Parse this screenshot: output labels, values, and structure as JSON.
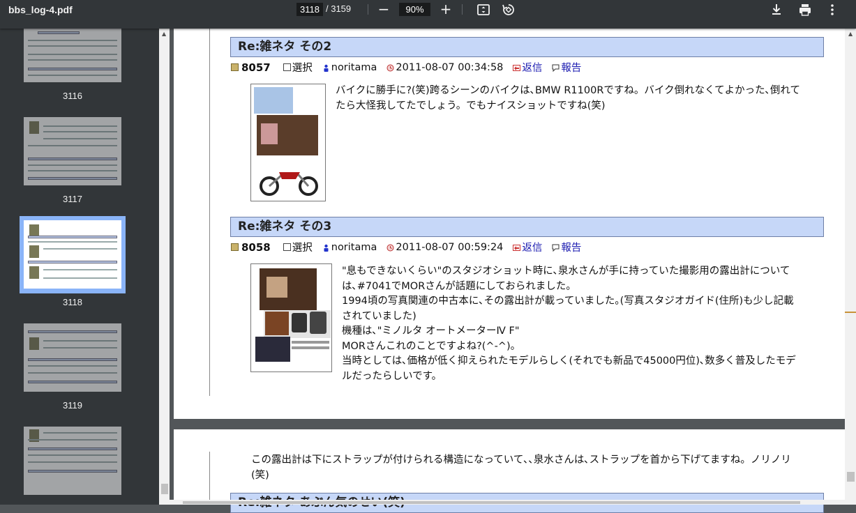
{
  "toolbar": {
    "file_name": "bbs_log-4.pdf",
    "page_current": "3118",
    "page_total": "/ 3159",
    "zoom_minus": "−",
    "zoom_level": "90%",
    "zoom_plus": "+",
    "icons": [
      "fit-page-icon",
      "rotate-icon",
      "download-icon",
      "print-icon",
      "more-options-icon"
    ]
  },
  "sidebar": {
    "thumbnails": [
      {
        "label": "3116"
      },
      {
        "label": "3117"
      },
      {
        "label": "3118",
        "selected": true
      },
      {
        "label": "3119"
      },
      {
        "label": ""
      }
    ]
  },
  "posts": [
    {
      "title": "Re:雑ネタ その2",
      "number": "8057",
      "select_label": "選択",
      "author": "noritama",
      "datetime": "2011-08-07 00:34:58",
      "reply": "返信",
      "report": "報告",
      "body": [
        "バイクに勝手に?(笑)跨るシーンのバイクは､BMW R1100Rですね。バイク倒れなくてよかった､倒れて",
        "たら大怪我してたでしょう。でもナイスショットですね(笑)"
      ]
    },
    {
      "title": "Re:雑ネタ その3",
      "number": "8058",
      "select_label": "選択",
      "author": "noritama",
      "datetime": "2011-08-07 00:59:24",
      "reply": "返信",
      "report": "報告",
      "body": [
        "\"息もできないくらい\"のスタジオショット時に､泉水さんが手に持っていた撮影用の露出計について",
        "は､#7041でMORさんが話題にしておられました。",
        "1994頃の写真関連の中古本に､その露出計が載っていました｡(写真スタジオガイド(住所)も少し記載",
        "されていました)",
        "機種は､\"ミノルタ オートメーターⅣ F\"",
        "MORさんこれのことですよね?(^-^)。",
        "当時としては､価格が低く抑えられたモデルらしく(それでも新品で45000円位)､数多く普及したモデ",
        "ルだったらしいです。"
      ]
    }
  ],
  "page2": {
    "body": [
      "この露出計は下にストラップが付けられる構造になっていて､､泉水さんは､ストラップを首から下げてますね。ノリノリ",
      "(笑)"
    ],
    "next_title": "Re:雑ネタ あぶん気のせい(笑)"
  },
  "colors": {
    "toolbar_bg": "#323639",
    "viewer_bg": "#525659",
    "title_bar_bg": "#c6d7f8",
    "link": "#1a1ab0",
    "selected_thumb": "#8ab4f8"
  }
}
